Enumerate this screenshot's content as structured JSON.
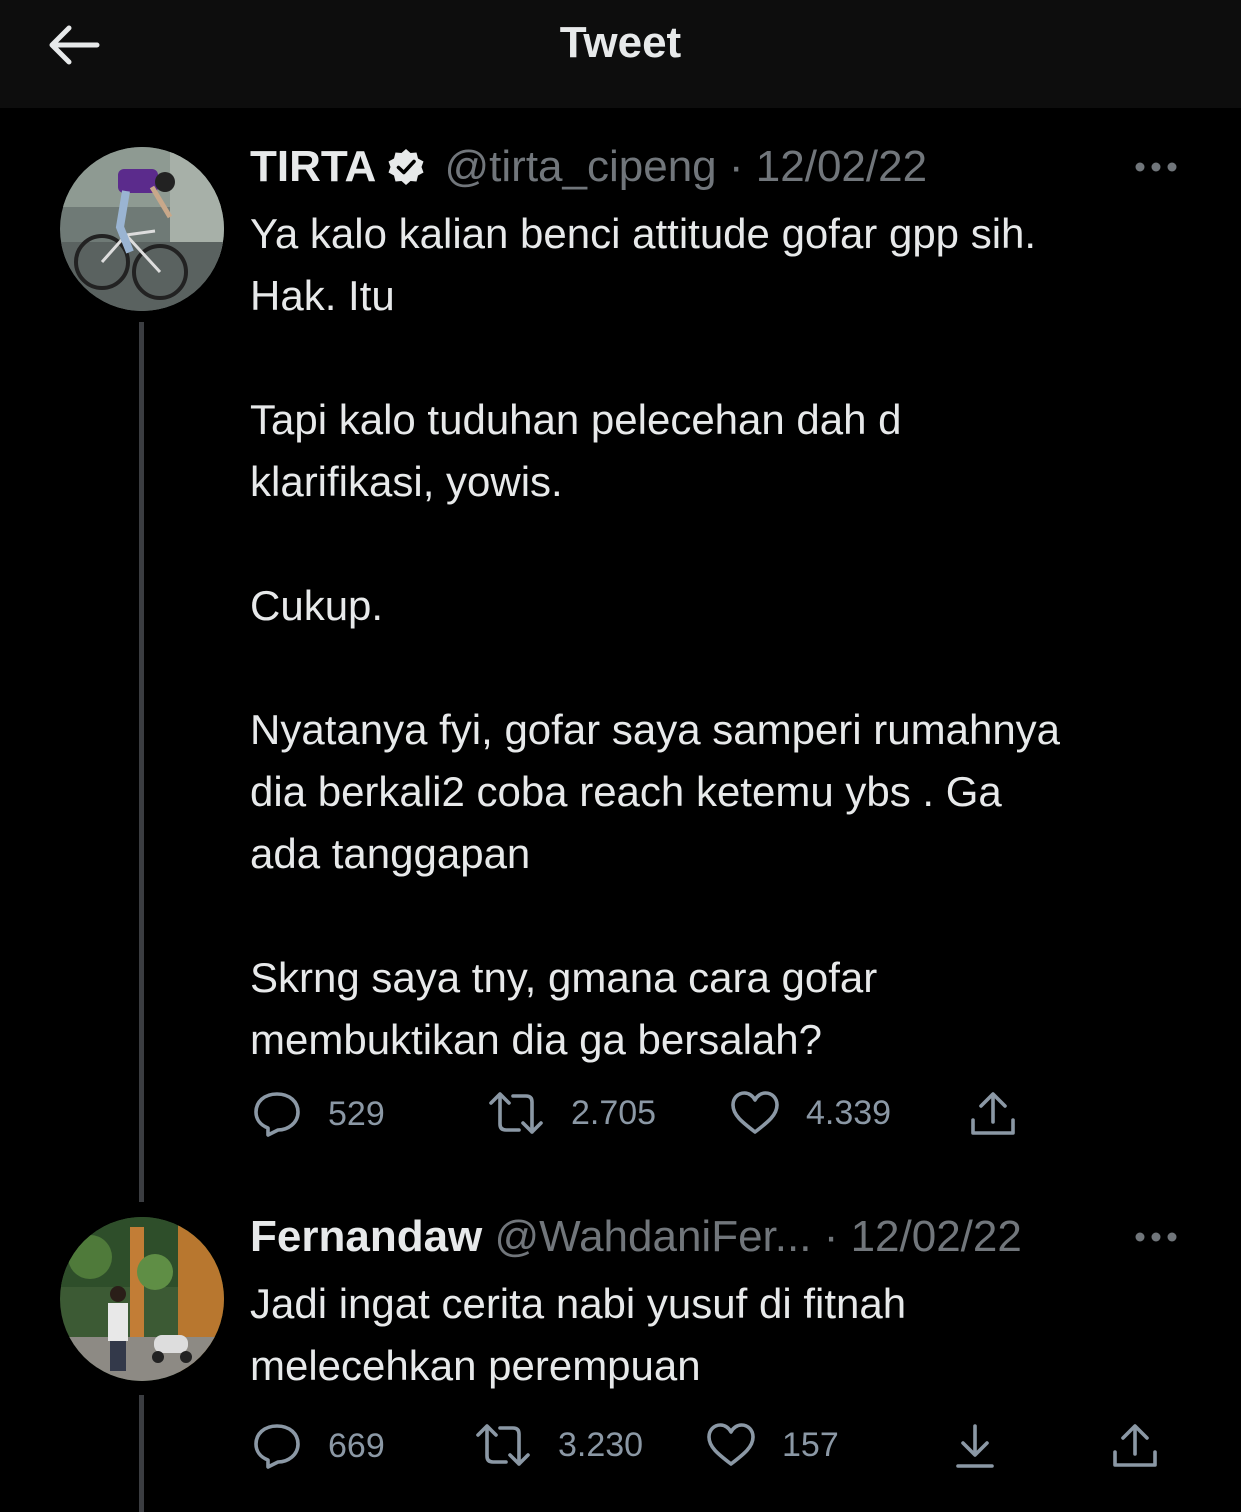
{
  "header": {
    "title": "Tweet",
    "back_icon": "arrow-left-icon"
  },
  "tweets": [
    {
      "name": "TIRTA",
      "verified": true,
      "handle": "@tirta_cipeng",
      "separator": "·",
      "date": "12/02/22",
      "text": "Ya kalo kalian benci attitude gofar gpp sih.\nHak. Itu\n\nTapi kalo tuduhan pelecehan dah d\nklarifikasi, yowis.\n\nCukup.\n\nNyatanya fyi, gofar saya samperi rumahnya\ndia berkali2 coba reach ketemu ybs . Ga\nada tanggapan\n\nSkrng saya tny, gmana cara gofar\nmembuktikan dia ga bersalah?",
      "stats": {
        "replies": "529",
        "retweets": "2.705",
        "likes": "4.339"
      }
    },
    {
      "name": "Fernandaw",
      "verified": false,
      "handle": "@WahdaniFer...",
      "separator": "·",
      "date": "12/02/22",
      "text": "Jadi ingat cerita nabi yusuf di fitnah\nmelecehkan perempuan",
      "stats": {
        "replies": "669",
        "retweets": "3.230",
        "likes": "157"
      }
    }
  ],
  "colors": {
    "background": "#000000",
    "text": "#e7e9ea",
    "muted": "#71767b",
    "thread_line": "#3b3d41"
  }
}
